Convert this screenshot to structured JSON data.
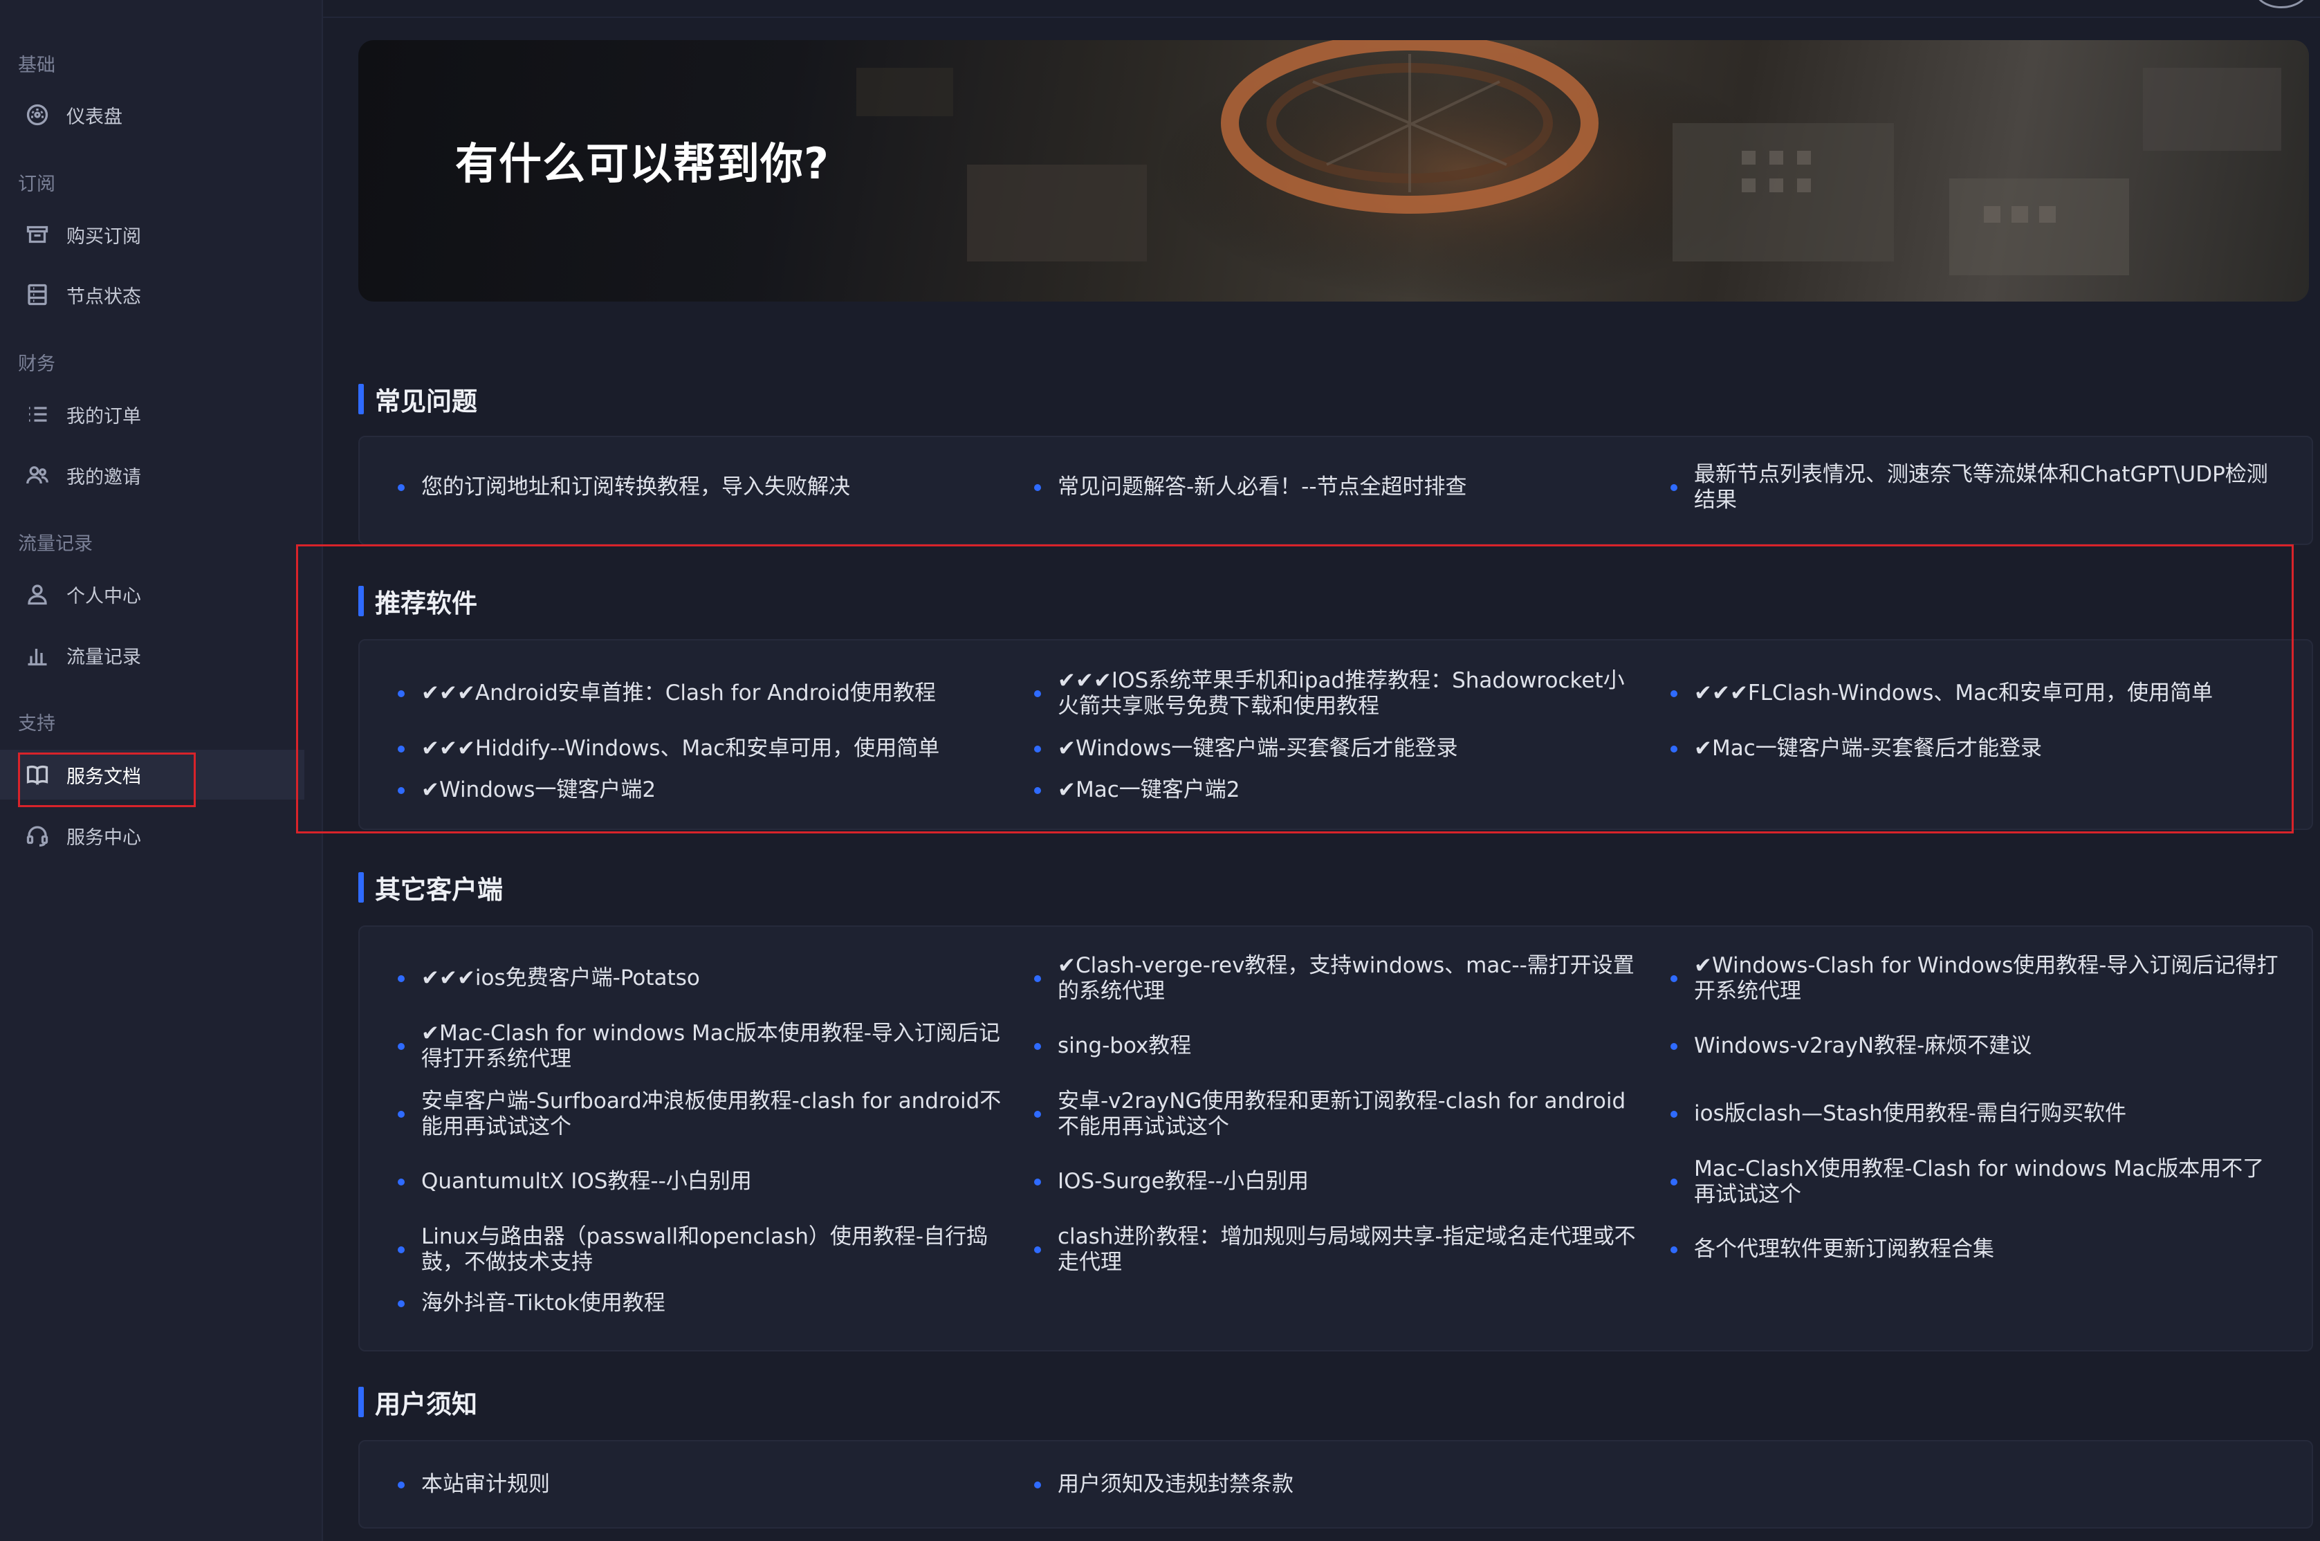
{
  "sidebar": {
    "sections": [
      {
        "label": "基础"
      },
      {
        "label": "订阅"
      },
      {
        "label": "财务"
      },
      {
        "label": "流量记录"
      },
      {
        "label": "支持"
      }
    ],
    "items": [
      {
        "label": "仪表盘",
        "icon": "dashboard-icon"
      },
      {
        "label": "购买订阅",
        "icon": "store-icon"
      },
      {
        "label": "节点状态",
        "icon": "server-icon"
      },
      {
        "label": "我的订单",
        "icon": "list-icon"
      },
      {
        "label": "我的邀请",
        "icon": "users-icon"
      },
      {
        "label": "个人中心",
        "icon": "user-icon"
      },
      {
        "label": "流量记录",
        "icon": "bar-chart-icon"
      },
      {
        "label": "服务文档",
        "icon": "book-icon",
        "active": true
      },
      {
        "label": "服务中心",
        "icon": "headset-icon"
      }
    ]
  },
  "hero": {
    "title": "有什么可以帮到你?"
  },
  "sections": [
    {
      "title": "常见问题",
      "items": [
        "您的订阅地址和订阅转换教程，导入失败解决",
        "常见问题解答-新人必看！--节点全超时排查",
        "最新节点列表情况、测速奈飞等流媒体和ChatGPT\\UDP检测结果"
      ]
    },
    {
      "title": "推荐软件",
      "items": [
        "✔✔✔Android安卓首推：Clash for Android使用教程",
        "✔✔✔IOS系统苹果手机和ipad推荐教程：Shadowrocket小火箭共享账号免费下载和使用教程",
        "✔✔✔FLClash-Windows、Mac和安卓可用，使用简单",
        "✔✔✔Hiddify--Windows、Mac和安卓可用，使用简单",
        "✔Windows一键客户端-买套餐后才能登录",
        "✔Mac一键客户端-买套餐后才能登录",
        "✔Windows一键客户端2",
        "✔Mac一键客户端2"
      ]
    },
    {
      "title": "其它客户端",
      "items": [
        "✔✔✔ios免费客户端-Potatso",
        "✔Clash-verge-rev教程，支持windows、mac--需打开设置的系统代理",
        "✔Windows-Clash for Windows使用教程-导入订阅后记得打开系统代理",
        "✔Mac-Clash for windows Mac版本使用教程-导入订阅后记得打开系统代理",
        "sing-box教程",
        "Windows-v2rayN教程-麻烦不建议",
        "安卓客户端-Surfboard冲浪板使用教程-clash for android不能用再试试这个",
        "安卓-v2rayNG使用教程和更新订阅教程-clash for android不能用再试试这个",
        "ios版clash—Stash使用教程-需自行购买软件",
        "QuantumultX IOS教程--小白别用",
        "IOS-Surge教程--小白别用",
        "Mac-ClashX使用教程-Clash for windows Mac版本用不了再试试这个",
        "Linux与路由器（passwall和openclash）使用教程-自行捣鼓，不做技术支持",
        "clash进阶教程：增加规则与局域网共享-指定域名走代理或不走代理",
        "各个代理软件更新订阅教程合集",
        "海外抖音-Tiktok使用教程"
      ]
    },
    {
      "title": "用户须知",
      "items": [
        "本站审计规则",
        "用户须知及违规封禁条款"
      ]
    }
  ],
  "colors": {
    "accent": "#2f6bff",
    "highlight": "#d8232a"
  }
}
